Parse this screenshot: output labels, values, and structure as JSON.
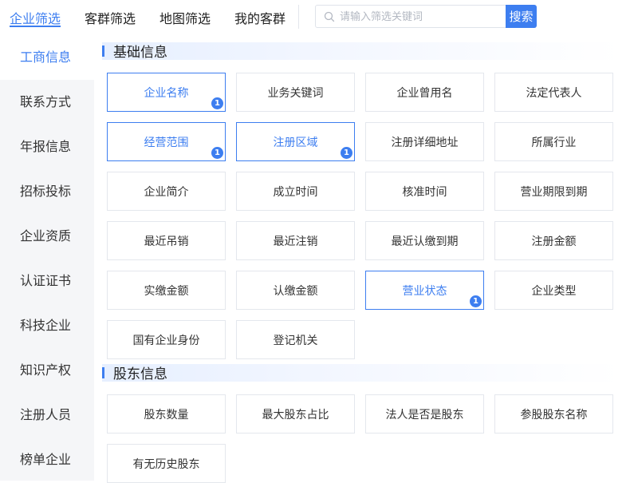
{
  "top_tabs": [
    {
      "label": "企业筛选",
      "active": true
    },
    {
      "label": "客群筛选",
      "active": false
    },
    {
      "label": "地图筛选",
      "active": false
    },
    {
      "label": "我的客群",
      "active": false
    }
  ],
  "search": {
    "placeholder": "请输入筛选关键词",
    "value": "",
    "button_label": "搜索",
    "icon": "search-icon"
  },
  "sidebar": {
    "items": [
      {
        "label": "工商信息",
        "active": true
      },
      {
        "label": "联系方式",
        "active": false
      },
      {
        "label": "年报信息",
        "active": false
      },
      {
        "label": "招标投标",
        "active": false
      },
      {
        "label": "企业资质",
        "active": false
      },
      {
        "label": "认证证书",
        "active": false
      },
      {
        "label": "科技企业",
        "active": false
      },
      {
        "label": "知识产权",
        "active": false
      },
      {
        "label": "注册人员",
        "active": false
      },
      {
        "label": "榜单企业",
        "active": false
      }
    ]
  },
  "sections": [
    {
      "title": "基础信息",
      "chips": [
        {
          "label": "企业名称",
          "selected": true,
          "badge": "1"
        },
        {
          "label": "业务关键词",
          "selected": false,
          "badge": ""
        },
        {
          "label": "企业曾用名",
          "selected": false,
          "badge": ""
        },
        {
          "label": "法定代表人",
          "selected": false,
          "badge": ""
        },
        {
          "label": "经营范围",
          "selected": true,
          "badge": "1"
        },
        {
          "label": "注册区域",
          "selected": true,
          "badge": "1"
        },
        {
          "label": "注册详细地址",
          "selected": false,
          "badge": ""
        },
        {
          "label": "所属行业",
          "selected": false,
          "badge": ""
        },
        {
          "label": "企业简介",
          "selected": false,
          "badge": ""
        },
        {
          "label": "成立时间",
          "selected": false,
          "badge": ""
        },
        {
          "label": "核准时间",
          "selected": false,
          "badge": ""
        },
        {
          "label": "营业期限到期",
          "selected": false,
          "badge": ""
        },
        {
          "label": "最近吊销",
          "selected": false,
          "badge": ""
        },
        {
          "label": "最近注销",
          "selected": false,
          "badge": ""
        },
        {
          "label": "最近认缴到期",
          "selected": false,
          "badge": ""
        },
        {
          "label": "注册金额",
          "selected": false,
          "badge": ""
        },
        {
          "label": "实缴金额",
          "selected": false,
          "badge": ""
        },
        {
          "label": "认缴金额",
          "selected": false,
          "badge": ""
        },
        {
          "label": "营业状态",
          "selected": true,
          "badge": "1"
        },
        {
          "label": "企业类型",
          "selected": false,
          "badge": ""
        },
        {
          "label": "国有企业身份",
          "selected": false,
          "badge": ""
        },
        {
          "label": "登记机关",
          "selected": false,
          "badge": ""
        }
      ]
    },
    {
      "title": "股东信息",
      "chips": [
        {
          "label": "股东数量",
          "selected": false,
          "badge": ""
        },
        {
          "label": "最大股东占比",
          "selected": false,
          "badge": ""
        },
        {
          "label": "法人是否是股东",
          "selected": false,
          "badge": ""
        },
        {
          "label": "参股股东名称",
          "selected": false,
          "badge": ""
        },
        {
          "label": "有无历史股东",
          "selected": false,
          "badge": ""
        }
      ]
    }
  ],
  "colors": {
    "accent": "#3d7ef0",
    "sidebar_bg": "#f5f6f8",
    "border": "#e4e7ed"
  }
}
